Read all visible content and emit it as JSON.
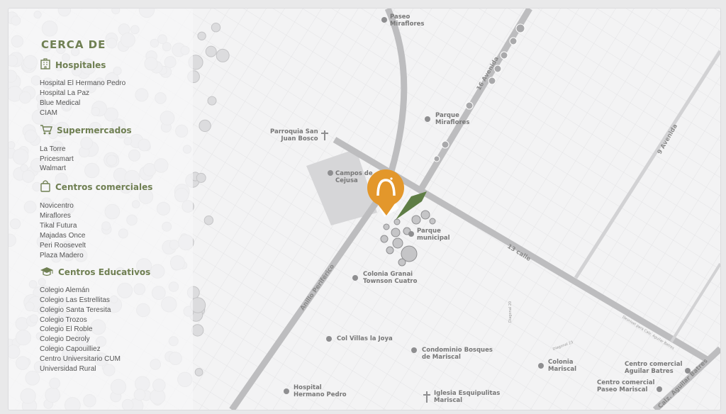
{
  "legend": {
    "title": "CERCA DE",
    "categories": [
      {
        "label": "Hospitales",
        "icon": "hospital-icon",
        "items": [
          "Hospital El Hermano Pedro",
          "Hospital La Paz",
          "Blue Medical",
          "CIAM"
        ]
      },
      {
        "label": "Supermercados",
        "icon": "shopping-cart-icon",
        "items": [
          "La Torre",
          "Pricesmart",
          "Walmart"
        ]
      },
      {
        "label": "Centros comerciales",
        "icon": "shopping-bag-icon",
        "items": [
          "Novicentro",
          "Miraflores",
          "Tikal Futura",
          "Majadas Once",
          "Peri Roosevelt",
          "Plaza Madero"
        ]
      },
      {
        "label": "Centros Educativos",
        "icon": "graduation-cap-icon",
        "items": [
          "Colegio Alemán",
          "Colegio Las Estrellitas",
          "Colegio Santa Teresita",
          "Colegio Trozos",
          "Colegio El Roble",
          "Colegio Decroly",
          "Colegio Capouilliez",
          "Centro Universitario CUM",
          "Universidad Rural"
        ]
      }
    ]
  },
  "map": {
    "places": {
      "paseo_miraflores": [
        "Paseo",
        "Miraflores"
      ],
      "parque_miraflores": [
        "Parque",
        "Miraflores"
      ],
      "parroquia": [
        "Parroquia San",
        "Juan Bosco"
      ],
      "campos": [
        "Campos de",
        "Cejusa"
      ],
      "parque_municipal": [
        "Parque",
        "municipal"
      ],
      "colonia_granai": [
        "Colonia Granai",
        "Townson Cuatro"
      ],
      "villas_joya": [
        "Col Villas la Joya"
      ],
      "bosques": [
        "Condominio Bosques",
        "de Mariscal"
      ],
      "colonia_mariscal": [
        "Colonia",
        "Mariscal"
      ],
      "aguilar": [
        "Centro comercial",
        "Aguilar Batres"
      ],
      "paseo_mariscal": [
        "Centro comercial",
        "Paseo Mariscal"
      ],
      "hospital_hp": [
        "Hospital",
        "Hermano Pedro"
      ],
      "iglesia": [
        "Iglesia Esquipulitas",
        "Mariscal"
      ]
    },
    "roads": {
      "av16": "16 Avenida",
      "av9": "9 Avenida",
      "calle13": "13 calle",
      "periferico": "Anillo Periférico",
      "aguilar_batres": "Calz. Aguilar Batres",
      "desnivel": "Desnivel para Calz. Aguilar Batres",
      "diagonal20": "Diagonal 20",
      "diagonal23": "Diagonal 23"
    },
    "colors": {
      "accent": "#e3972b",
      "green": "#5e7d45",
      "road": "#bcbcbe"
    }
  }
}
